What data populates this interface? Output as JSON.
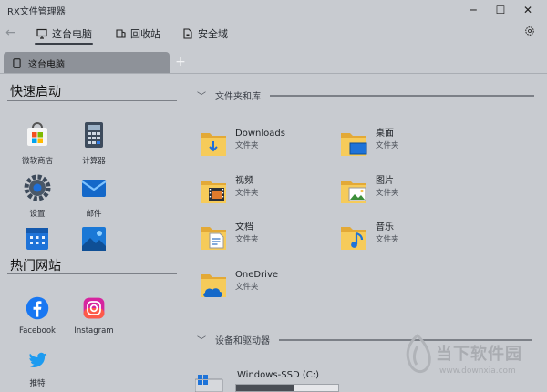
{
  "window": {
    "title": "RX文件管理器",
    "min_glyph": "─",
    "max_glyph": "☐",
    "close_glyph": "✕"
  },
  "nav": {
    "back_glyph": "←",
    "items": [
      {
        "label": "这台电脑",
        "icon": "monitor-icon"
      },
      {
        "label": "回收站",
        "icon": "recycle-bin-icon"
      },
      {
        "label": "安全域",
        "icon": "secure-file-icon"
      }
    ],
    "settings_icon": "gear-icon"
  },
  "tabs": {
    "items": [
      {
        "label": "这台电脑",
        "icon": "tablet-icon"
      }
    ],
    "add_glyph": "+"
  },
  "quick_launch": {
    "title": "快速启动",
    "apps": [
      {
        "label": "微软商店",
        "icon": "store-icon"
      },
      {
        "label": "计算器",
        "icon": "calculator-icon"
      },
      {
        "label": "设置",
        "icon": "settings-gear-icon"
      },
      {
        "label": "邮件",
        "icon": "mail-icon"
      },
      {
        "label": "",
        "icon": "calendar-icon"
      },
      {
        "label": "",
        "icon": "photos-icon"
      }
    ]
  },
  "hot_sites": {
    "title": "热门网站",
    "sites": [
      {
        "label": "Facebook",
        "icon": "facebook-icon"
      },
      {
        "label": "Instagram",
        "icon": "instagram-icon"
      },
      {
        "label": "推特",
        "icon": "twitter-icon"
      }
    ]
  },
  "folders_section": {
    "title": "文件夹和库",
    "chevron": "﹀",
    "folders": [
      {
        "name": "Downloads",
        "type": "文件夹",
        "icon": "downloads-folder-icon"
      },
      {
        "name": "桌面",
        "type": "文件夹",
        "icon": "desktop-folder-icon"
      },
      {
        "name": "视频",
        "type": "文件夹",
        "icon": "videos-folder-icon"
      },
      {
        "name": "图片",
        "type": "文件夹",
        "icon": "pictures-folder-icon"
      },
      {
        "name": "文档",
        "type": "文件夹",
        "icon": "documents-folder-icon"
      },
      {
        "name": "音乐",
        "type": "文件夹",
        "icon": "music-folder-icon"
      },
      {
        "name": "OneDrive",
        "type": "文件夹",
        "icon": "onedrive-folder-icon"
      }
    ]
  },
  "drives_section": {
    "title": "设备和驱动器",
    "chevron": "﹀",
    "drives": [
      {
        "name": "Windows-SSD (C:)",
        "icon": "windows-drive-icon",
        "used_fraction": 0.56
      }
    ]
  },
  "watermark": {
    "text": "当下软件园",
    "url": "www.downxia.com"
  },
  "colors": {
    "background": "#c8cbd0",
    "folder": "#f2c24f",
    "accent_blue": "#1e6fd9"
  }
}
